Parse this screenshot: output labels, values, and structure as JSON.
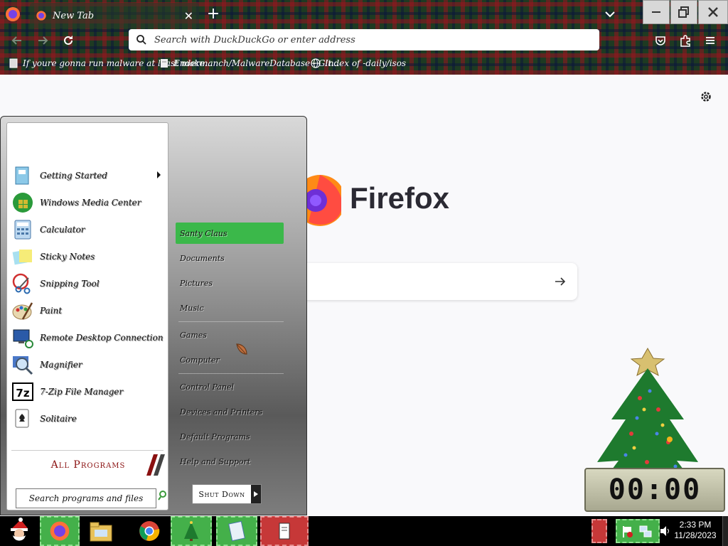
{
  "browser": {
    "tab_title": "New Tab",
    "address_placeholder": "Search with DuckDuckGo or enter address",
    "bookmarks": [
      {
        "label": "If youre gonna run malware at least make...",
        "icon": "book-icon"
      },
      {
        "label": "Endermanch/MalwareDatabase - Git...",
        "icon": "page-icon"
      },
      {
        "label": "Index of -daily/isos",
        "icon": "globe-icon"
      }
    ]
  },
  "newtab": {
    "brand": "Firefox"
  },
  "start_menu": {
    "left_items": [
      {
        "label": "Getting Started",
        "icon": "getting-started-icon",
        "has_submenu": true
      },
      {
        "label": "Windows Media Center",
        "icon": "media-center-icon"
      },
      {
        "label": "Calculator",
        "icon": "calculator-icon"
      },
      {
        "label": "Sticky Notes",
        "icon": "sticky-notes-icon"
      },
      {
        "label": "Snipping Tool",
        "icon": "snipping-tool-icon"
      },
      {
        "label": "Paint",
        "icon": "paint-icon"
      },
      {
        "label": "Remote Desktop Connection",
        "icon": "remote-desktop-icon"
      },
      {
        "label": "Magnifier",
        "icon": "magnifier-icon"
      },
      {
        "label": "7-Zip File Manager",
        "icon": "7zip-icon"
      },
      {
        "label": "Solitaire",
        "icon": "solitaire-icon"
      }
    ],
    "all_programs": "All Programs",
    "search_placeholder": "Search programs and files",
    "right_items": [
      {
        "label": "Santy Claus",
        "selected": true
      },
      {
        "label": "Documents"
      },
      {
        "label": "Pictures"
      },
      {
        "label": "Music"
      },
      {
        "label": "Games"
      },
      {
        "label": "Computer"
      },
      {
        "label": "Control Panel"
      },
      {
        "label": "Devices and Printers"
      },
      {
        "label": "Default Programs"
      },
      {
        "label": "Help and Support"
      }
    ],
    "shutdown": "Shut Down"
  },
  "gadget": {
    "clock_display": "00:00"
  },
  "taskbar": {
    "time": "2:33 PM",
    "date": "11/28/2023"
  },
  "colors": {
    "selection_green": "#3bb84a",
    "taskbar": "#000000",
    "all_programs_red": "#8a1010"
  }
}
